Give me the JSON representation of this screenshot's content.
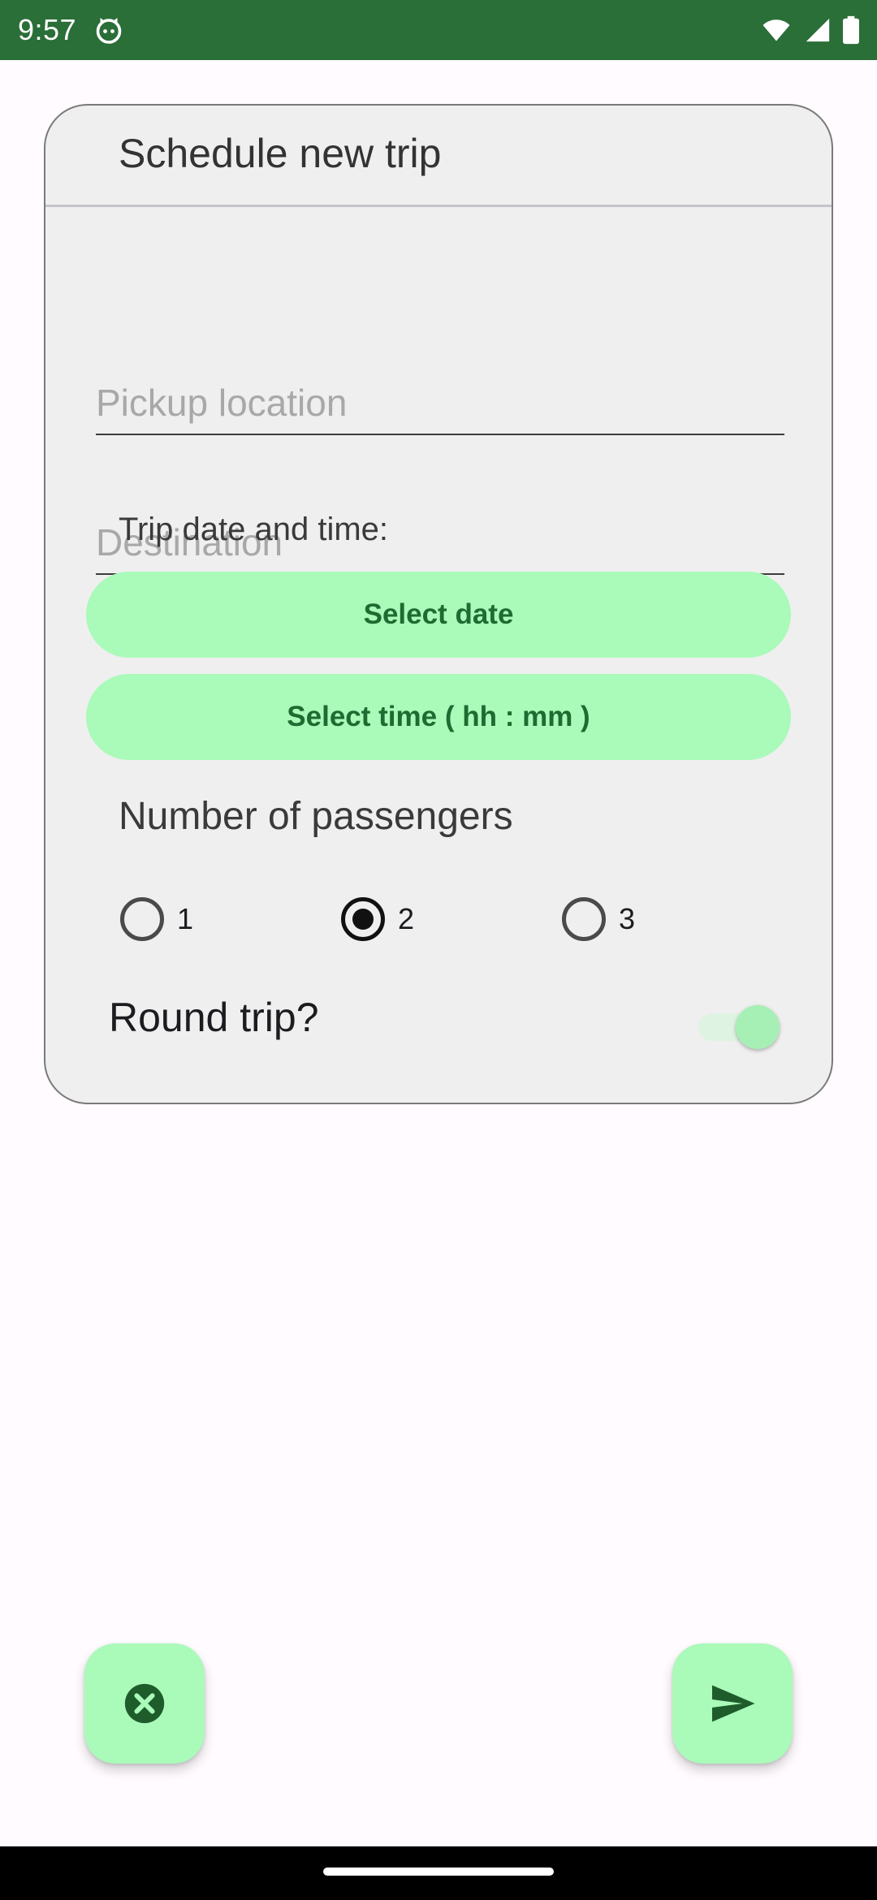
{
  "status_bar": {
    "time": "9:57",
    "icons": [
      "cat-icon",
      "wifi-icon",
      "signal-icon",
      "battery-icon"
    ]
  },
  "card": {
    "title": "Schedule new trip",
    "pickup": {
      "placeholder": "Pickup location",
      "value": ""
    },
    "destination": {
      "placeholder": "Destination",
      "value": ""
    },
    "date_time_label": "Trip date and time:",
    "select_date_label": "Select date",
    "select_time_label": "Select time ( hh : mm )",
    "passengers_label": "Number of passengers",
    "passenger_options": [
      "1",
      "2",
      "3"
    ],
    "passenger_selected": "2",
    "round_trip_label": "Round trip?",
    "round_trip_on": true
  },
  "actions": {
    "cancel_icon": "cancel-circle-icon",
    "send_icon": "send-icon"
  },
  "colors": {
    "status_bar": "#2a6e38",
    "accent": "#aafaba",
    "accent_text": "#1f6b31",
    "card_bg": "#efefef",
    "page_bg": "#fffbfe"
  }
}
